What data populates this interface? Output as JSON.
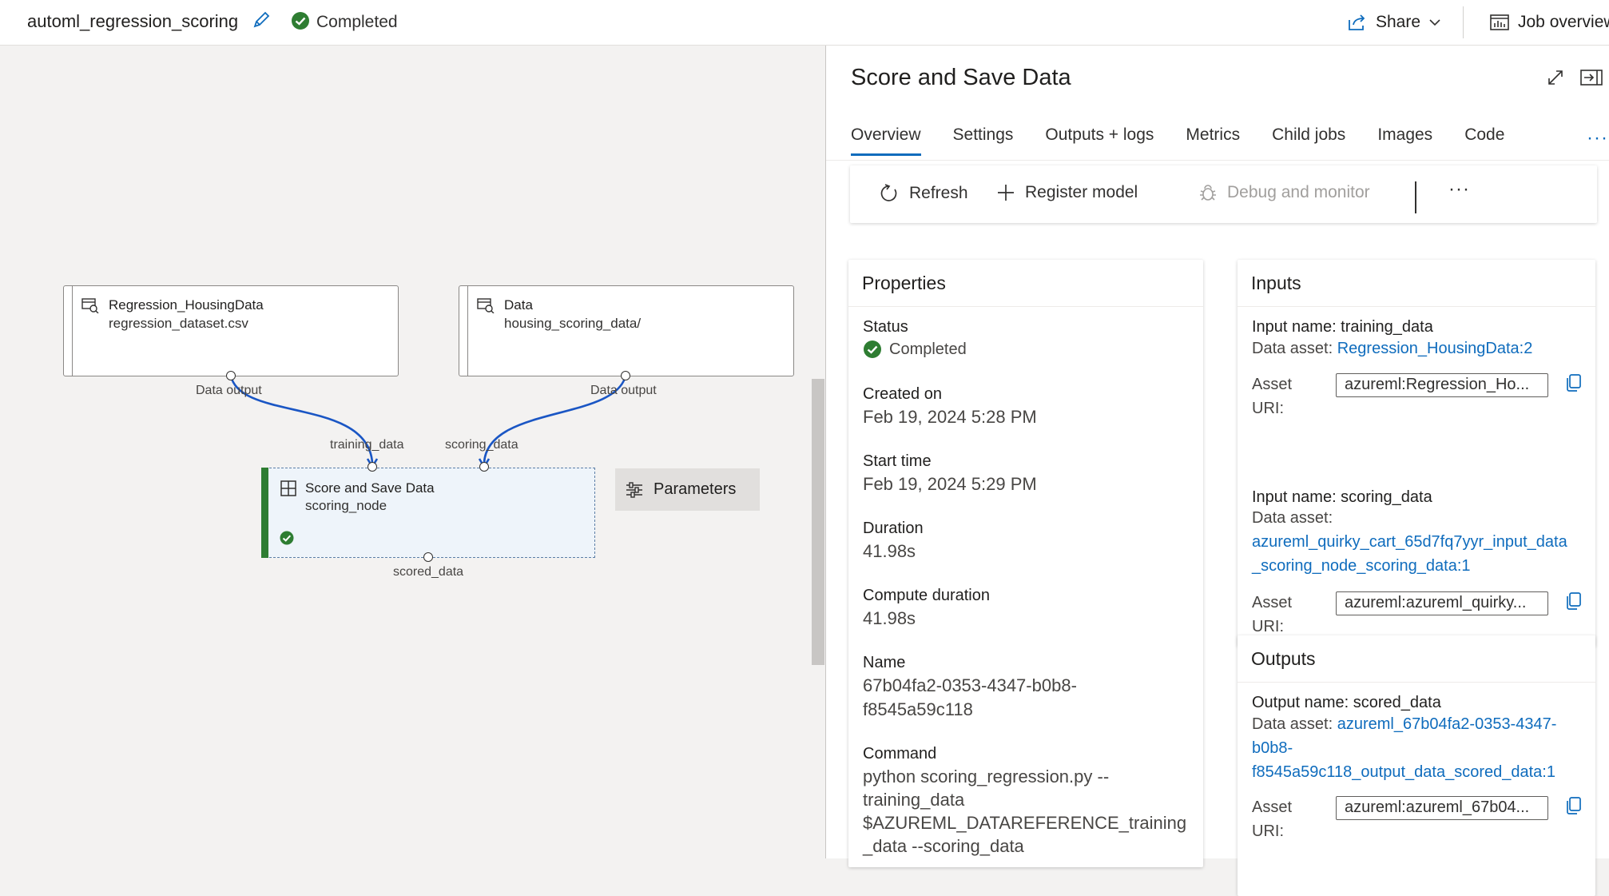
{
  "header": {
    "job_name": "automl_regression_scoring",
    "status": "Completed",
    "share_label": "Share",
    "job_overview_label": "Job overview"
  },
  "graph": {
    "nodes": [
      {
        "title": "Regression_HousingData",
        "subtitle": "regression_dataset.csv",
        "output_label": "Data output"
      },
      {
        "title": "Data",
        "subtitle": "housing_scoring_data/",
        "output_label": "Data output"
      }
    ],
    "score_node": {
      "title": "Score and Save Data",
      "subtitle": "scoring_node",
      "input1_label": "training_data",
      "input2_label": "scoring_data",
      "output_label": "scored_data"
    },
    "parameters_label": "Parameters"
  },
  "panel": {
    "title": "Score and Save Data",
    "tabs": [
      "Overview",
      "Settings",
      "Outputs + logs",
      "Metrics",
      "Child jobs",
      "Images",
      "Code"
    ],
    "more_tabs": "···",
    "toolbar": {
      "refresh": "Refresh",
      "register": "Register model",
      "debug": "Debug and monitor",
      "more": "···"
    },
    "properties": {
      "heading": "Properties",
      "status_label": "Status",
      "status_value": "Completed",
      "created_label": "Created on",
      "created_value": "Feb 19, 2024 5:28 PM",
      "start_label": "Start time",
      "start_value": "Feb 19, 2024 5:29 PM",
      "duration_label": "Duration",
      "duration_value": "41.98s",
      "compute_label": "Compute duration",
      "compute_value": "41.98s",
      "name_label": "Name",
      "name_line1": "67b04fa2-0353-4347-b0b8-",
      "name_line2": "f8545a59c118",
      "command_label": "Command",
      "command_line1": "python scoring_regression.py --",
      "command_line2": "training_data",
      "command_line3": "$AZUREML_DATAREFERENCE_training",
      "command_line4": "_data --scoring_data"
    },
    "inputs": {
      "heading": "Inputs",
      "input1_name": "Input name: training_data",
      "input1_asset_label": "Data asset:",
      "input1_asset_link": "Regression_HousingData:2",
      "input1_uri_label1": "Asset",
      "input1_uri_label2": "URI:",
      "input1_uri": "azureml:Regression_Ho...",
      "input2_name": "Input name: scoring_data",
      "input2_asset_label": "Data asset:",
      "input2_link_line1": "azureml_quirky_cart_65d7fq7yyr_input_data",
      "input2_link_line2": "_scoring_node_scoring_data:1",
      "input2_uri_label1": "Asset",
      "input2_uri_label2": "URI:",
      "input2_uri": "azureml:azureml_quirky..."
    },
    "outputs": {
      "heading": "Outputs",
      "output_name": "Output name: scored_data",
      "asset_label": "Data asset:",
      "link_line1": "azureml_67b04fa2-0353-4347-",
      "link_line2": "b0b8-",
      "link_line3": "f8545a59c118_output_data_scored_data:1",
      "uri_label1": "Asset",
      "uri_label2": "URI:",
      "uri": "azureml:azureml_67b04..."
    }
  },
  "colors": {
    "accent": "#0f6cbd",
    "success": "#2e7d32",
    "edge": "#1a56c4"
  }
}
